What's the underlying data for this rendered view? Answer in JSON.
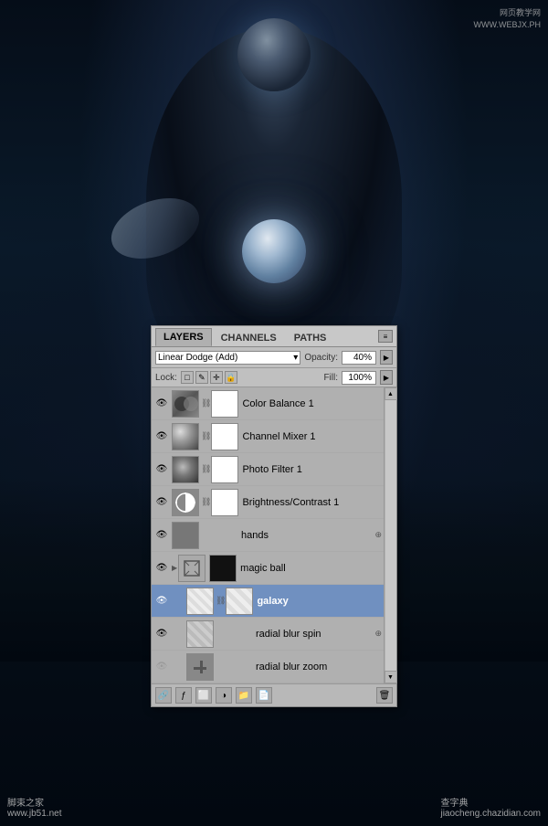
{
  "watermarks": {
    "top_right_line1": "网页教学网",
    "top_right_line2": "WWW.WEBJX.PH",
    "bottom_left": "脚束之家",
    "bottom_left_sub": "www.jb51.net",
    "bottom_right": "查字典",
    "bottom_right_sub": "jiaocheng.chazidian.com"
  },
  "panel": {
    "tabs": [
      {
        "label": "LAYERS",
        "active": true
      },
      {
        "label": "CHANNELS",
        "active": false
      },
      {
        "label": "PATHS",
        "active": false
      }
    ],
    "blend_mode": "Linear Dodge (Add)",
    "opacity_label": "Opacity:",
    "opacity_value": "40%",
    "lock_label": "Lock:",
    "fill_label": "Fill:",
    "fill_value": "100%",
    "layers": [
      {
        "id": "color-balance",
        "visible": true,
        "thumb_type": "adjustment",
        "thumb2_type": "white",
        "name": "Color Balance 1",
        "has_link": true,
        "selected": false,
        "fx": false,
        "indent": false
      },
      {
        "id": "channel-mixer",
        "visible": true,
        "thumb_type": "channel-mixer",
        "thumb2_type": "white",
        "name": "Channel Mixer 1",
        "has_link": true,
        "selected": false,
        "fx": false,
        "indent": false
      },
      {
        "id": "photo-filter",
        "visible": true,
        "thumb_type": "photo-filter",
        "thumb2_type": "white",
        "name": "Photo Filter 1",
        "has_link": true,
        "selected": false,
        "fx": false,
        "indent": false
      },
      {
        "id": "brightness-contrast",
        "visible": true,
        "thumb_type": "brightness",
        "thumb2_type": "white",
        "name": "Brightness/Contrast 1",
        "has_link": true,
        "selected": false,
        "fx": false,
        "indent": false
      },
      {
        "id": "hands",
        "visible": true,
        "thumb_type": "hands",
        "thumb2_type": null,
        "name": "hands",
        "has_link": false,
        "selected": false,
        "fx": true,
        "indent": false
      },
      {
        "id": "magic-ball-group",
        "visible": true,
        "thumb_type": "group",
        "thumb2_type": "black",
        "name": "magic ball",
        "has_link": false,
        "selected": false,
        "fx": false,
        "indent": false,
        "is_group": true
      },
      {
        "id": "galaxy",
        "visible": true,
        "thumb_type": "galaxy",
        "thumb2_type": "galaxy2",
        "name": "galaxy",
        "has_link": true,
        "selected": true,
        "fx": false,
        "indent": true
      },
      {
        "id": "radial-blur-spin",
        "visible": true,
        "thumb_type": "radial",
        "thumb2_type": "radial2",
        "name": "radial blur spin",
        "has_link": false,
        "selected": false,
        "fx": true,
        "indent": true
      },
      {
        "id": "radial-blur-zoom",
        "visible": false,
        "thumb_type": "radial",
        "thumb2_type": null,
        "name": "radial blur zoom",
        "has_link": false,
        "selected": false,
        "fx": false,
        "indent": true
      }
    ],
    "bottom_icons": [
      "fx-icon",
      "mask-icon",
      "adjustment-icon",
      "group-icon",
      "delete-icon"
    ]
  }
}
